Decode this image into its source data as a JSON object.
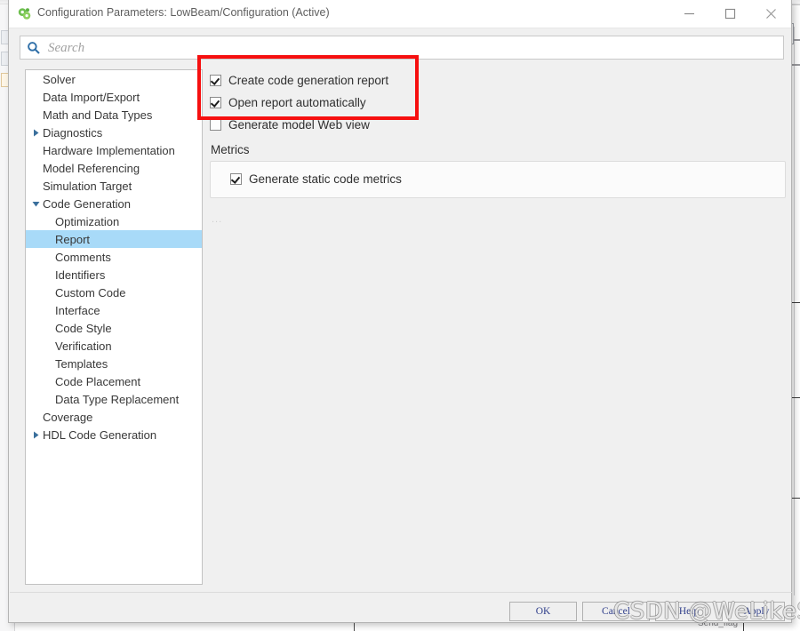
{
  "window": {
    "title": "Configuration Parameters: LowBeam/Configuration (Active)",
    "app_icon": "simulink-icon",
    "minimize_icon": "minimize-icon",
    "maximize_icon": "maximize-icon",
    "close_icon": "close-icon"
  },
  "search": {
    "icon": "search-icon",
    "value": "",
    "placeholder": "Search"
  },
  "tree": {
    "selected": "Report",
    "items": [
      {
        "label": "Solver",
        "level": 0,
        "arrow": "none"
      },
      {
        "label": "Data Import/Export",
        "level": 0,
        "arrow": "none"
      },
      {
        "label": "Math and Data Types",
        "level": 0,
        "arrow": "none"
      },
      {
        "label": "Diagnostics",
        "level": 0,
        "arrow": "collapsed"
      },
      {
        "label": "Hardware Implementation",
        "level": 0,
        "arrow": "none"
      },
      {
        "label": "Model Referencing",
        "level": 0,
        "arrow": "none"
      },
      {
        "label": "Simulation Target",
        "level": 0,
        "arrow": "none"
      },
      {
        "label": "Code Generation",
        "level": 0,
        "arrow": "expanded"
      },
      {
        "label": "Optimization",
        "level": 1,
        "arrow": "none"
      },
      {
        "label": "Report",
        "level": 1,
        "arrow": "none"
      },
      {
        "label": "Comments",
        "level": 1,
        "arrow": "none"
      },
      {
        "label": "Identifiers",
        "level": 1,
        "arrow": "none"
      },
      {
        "label": "Custom Code",
        "level": 1,
        "arrow": "none"
      },
      {
        "label": "Interface",
        "level": 1,
        "arrow": "none"
      },
      {
        "label": "Code Style",
        "level": 1,
        "arrow": "none"
      },
      {
        "label": "Verification",
        "level": 1,
        "arrow": "none"
      },
      {
        "label": "Templates",
        "level": 1,
        "arrow": "none"
      },
      {
        "label": "Code Placement",
        "level": 1,
        "arrow": "none"
      },
      {
        "label": "Data Type Replacement",
        "level": 1,
        "arrow": "none"
      },
      {
        "label": "Coverage",
        "level": 0,
        "arrow": "none"
      },
      {
        "label": "HDL Code Generation",
        "level": 0,
        "arrow": "collapsed"
      }
    ]
  },
  "content": {
    "checkboxes": [
      {
        "label": "Create code generation report",
        "checked": true
      },
      {
        "label": "Open report automatically",
        "checked": true
      },
      {
        "label": "Generate model Web view",
        "checked": false
      }
    ],
    "metrics_group": {
      "label": "Metrics",
      "checkbox": {
        "label": "Generate static code metrics",
        "checked": true
      }
    },
    "ellipsis": "..."
  },
  "annotation": {
    "color": "#f60f0f",
    "highlights": [
      "Create code generation report",
      "Open report automatically"
    ]
  },
  "footer": {
    "ok_label": "OK",
    "cancel_label": "Cancel",
    "help_label": "Help",
    "apply_label": "Apply"
  },
  "watermark": {
    "text": "CSDN @WeLikeStudy"
  },
  "background": {
    "block_label": "Send_flag"
  },
  "colors": {
    "selection": "#a8daf8",
    "annotation": "#f60f0f",
    "dialog_bg": "#f0f0f0",
    "button_text": "#2f3e8a"
  }
}
